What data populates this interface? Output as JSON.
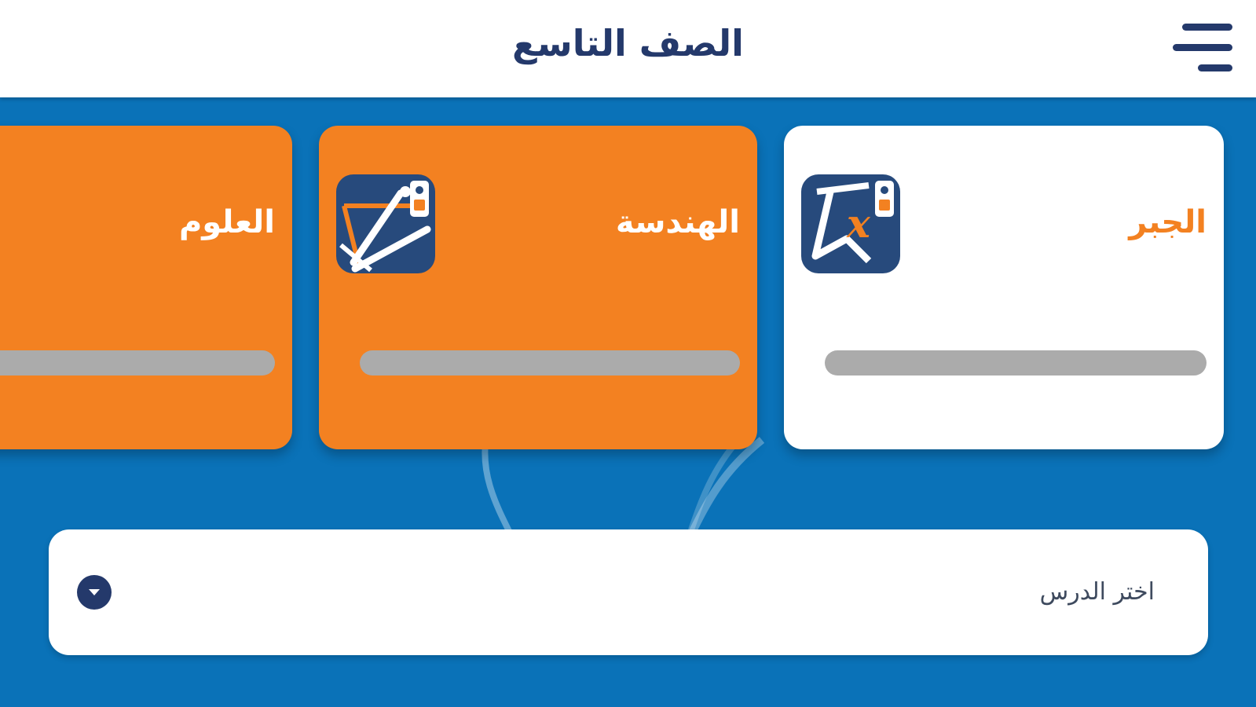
{
  "header": {
    "title": "الصف التاسع",
    "menu_icon": "hamburger-menu-icon"
  },
  "colors": {
    "primary_blue": "#0a72b8",
    "navy": "#24396b",
    "orange": "#f38121",
    "card_white": "#ffffff",
    "progress_gray": "#ababab"
  },
  "subjects": [
    {
      "title": "الجبر",
      "icon": "algebra-icon",
      "selected": true,
      "progress": 0
    },
    {
      "title": "الهندسة",
      "icon": "geometry-icon",
      "selected": false,
      "progress": 0
    },
    {
      "title": "العلوم",
      "icon": "",
      "selected": false,
      "progress": 0
    }
  ],
  "lesson_select": {
    "placeholder": "اختر الدرس",
    "icon": "chevron-down-icon"
  }
}
